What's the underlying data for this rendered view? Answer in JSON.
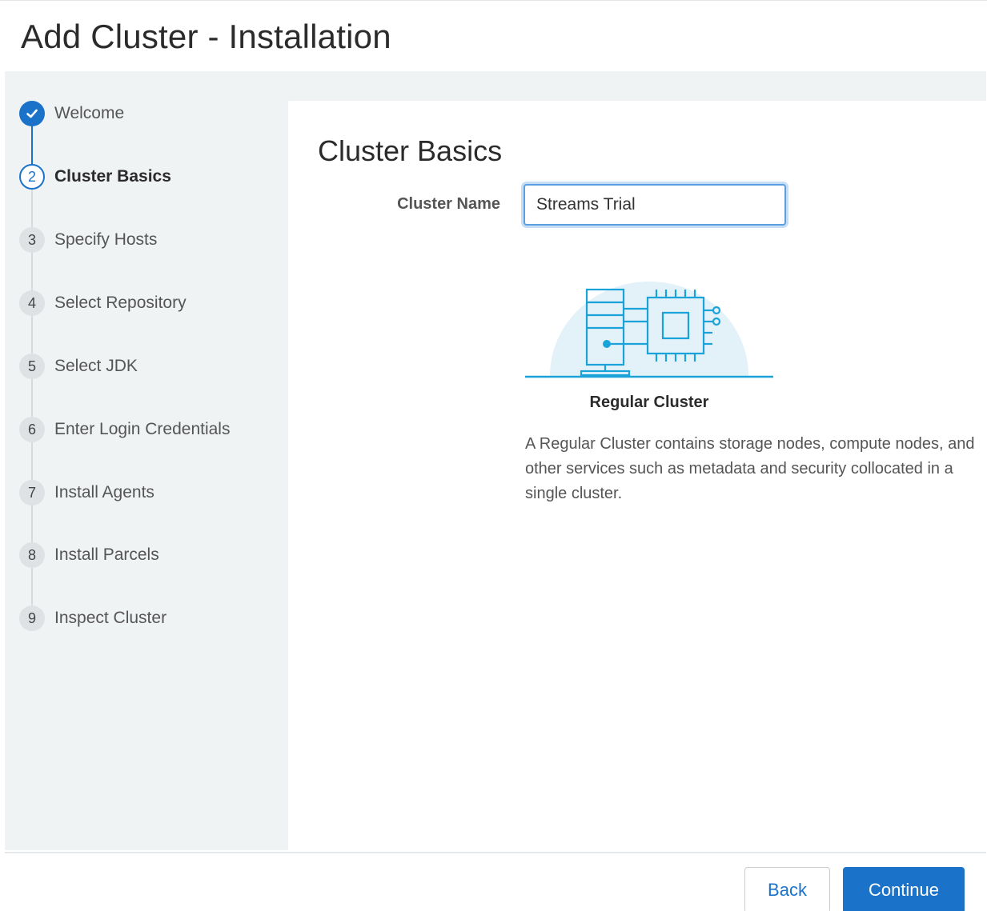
{
  "page": {
    "title": "Add Cluster - Installation"
  },
  "steps": [
    {
      "number": "",
      "label": "Welcome",
      "state": "done"
    },
    {
      "number": "2",
      "label": "Cluster Basics",
      "state": "current"
    },
    {
      "number": "3",
      "label": "Specify Hosts",
      "state": "pending"
    },
    {
      "number": "4",
      "label": "Select Repository",
      "state": "pending"
    },
    {
      "number": "5",
      "label": "Select JDK",
      "state": "pending"
    },
    {
      "number": "6",
      "label": "Enter Login Credentials",
      "state": "pending"
    },
    {
      "number": "7",
      "label": "Install Agents",
      "state": "pending"
    },
    {
      "number": "8",
      "label": "Install Parcels",
      "state": "pending"
    },
    {
      "number": "9",
      "label": "Inspect Cluster",
      "state": "pending"
    }
  ],
  "main": {
    "section_title": "Cluster Basics",
    "cluster_name_label": "Cluster Name",
    "cluster_name_value": "Streams Trial",
    "cluster_type": {
      "label": "Regular Cluster",
      "description": "A Regular Cluster contains storage nodes, compute nodes, and other services such as metadata and security collocated in a single cluster.",
      "icon": "server-chip-icon"
    }
  },
  "footer": {
    "back_label": "Back",
    "continue_label": "Continue"
  },
  "colors": {
    "accent": "#1a73c9",
    "illustration": "#1aa3d9",
    "illustration_bg": "#e3f1f9",
    "panel_bg": "#f0f3f4"
  }
}
